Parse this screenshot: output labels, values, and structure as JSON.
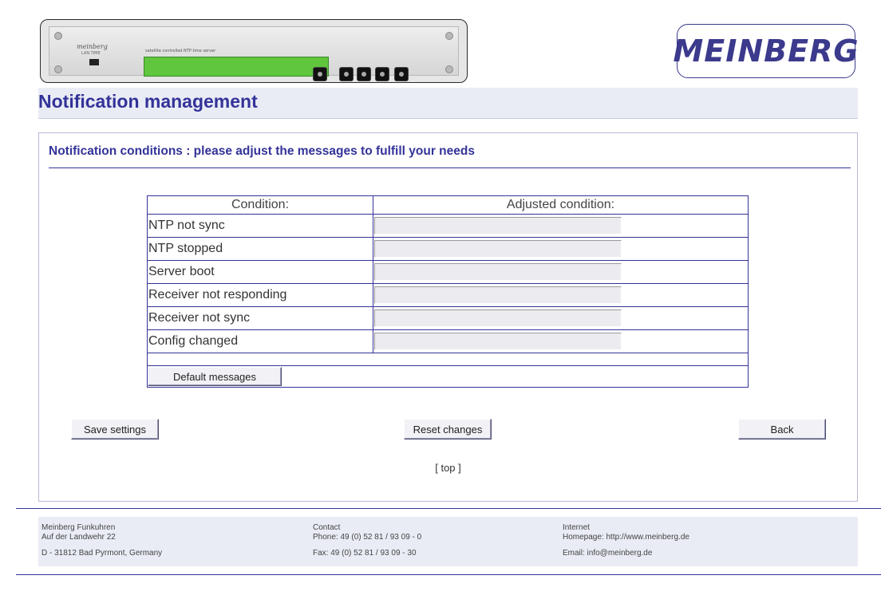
{
  "header": {
    "device_image_alt": "LANTIME device",
    "device_brand": "meinberg",
    "device_model": "LAN TIME",
    "device_caption": "satellite controlled NTP time server",
    "logo_text": "MEINBERG"
  },
  "page": {
    "title": "Notification management"
  },
  "section": {
    "title": "Notification conditions : please adjust the messages to fulfill your needs"
  },
  "table": {
    "col_condition": "Condition:",
    "col_adjusted": "Adjusted condition:",
    "rows": [
      {
        "label": "NTP not sync",
        "value": ""
      },
      {
        "label": "NTP stopped",
        "value": ""
      },
      {
        "label": "Server boot",
        "value": ""
      },
      {
        "label": "Receiver not responding",
        "value": ""
      },
      {
        "label": "Receiver not sync",
        "value": ""
      },
      {
        "label": "Config changed",
        "value": ""
      }
    ],
    "default_button": "Default messages"
  },
  "actions": {
    "save": "Save settings",
    "reset": "Reset changes",
    "back": "Back",
    "top_link": "[ top ]"
  },
  "footer": {
    "company": "Meinberg Funkuhren",
    "street": "Auf der Landwehr 22",
    "city": "D - 31812 Bad Pyrmont, Germany",
    "contact_label": "Contact",
    "phone": "Phone: 49 (0) 52 81 / 93 09 - 0",
    "fax": "Fax: 49 (0) 52 81 / 93 09 - 30",
    "internet_label": "Internet",
    "homepage": "Homepage: http://www.meinberg.de",
    "email": "Email: info@meinberg.de"
  },
  "colors": {
    "accent": "#333399",
    "panel_bg": "#eaecf5",
    "lcd": "#5fc63d"
  }
}
